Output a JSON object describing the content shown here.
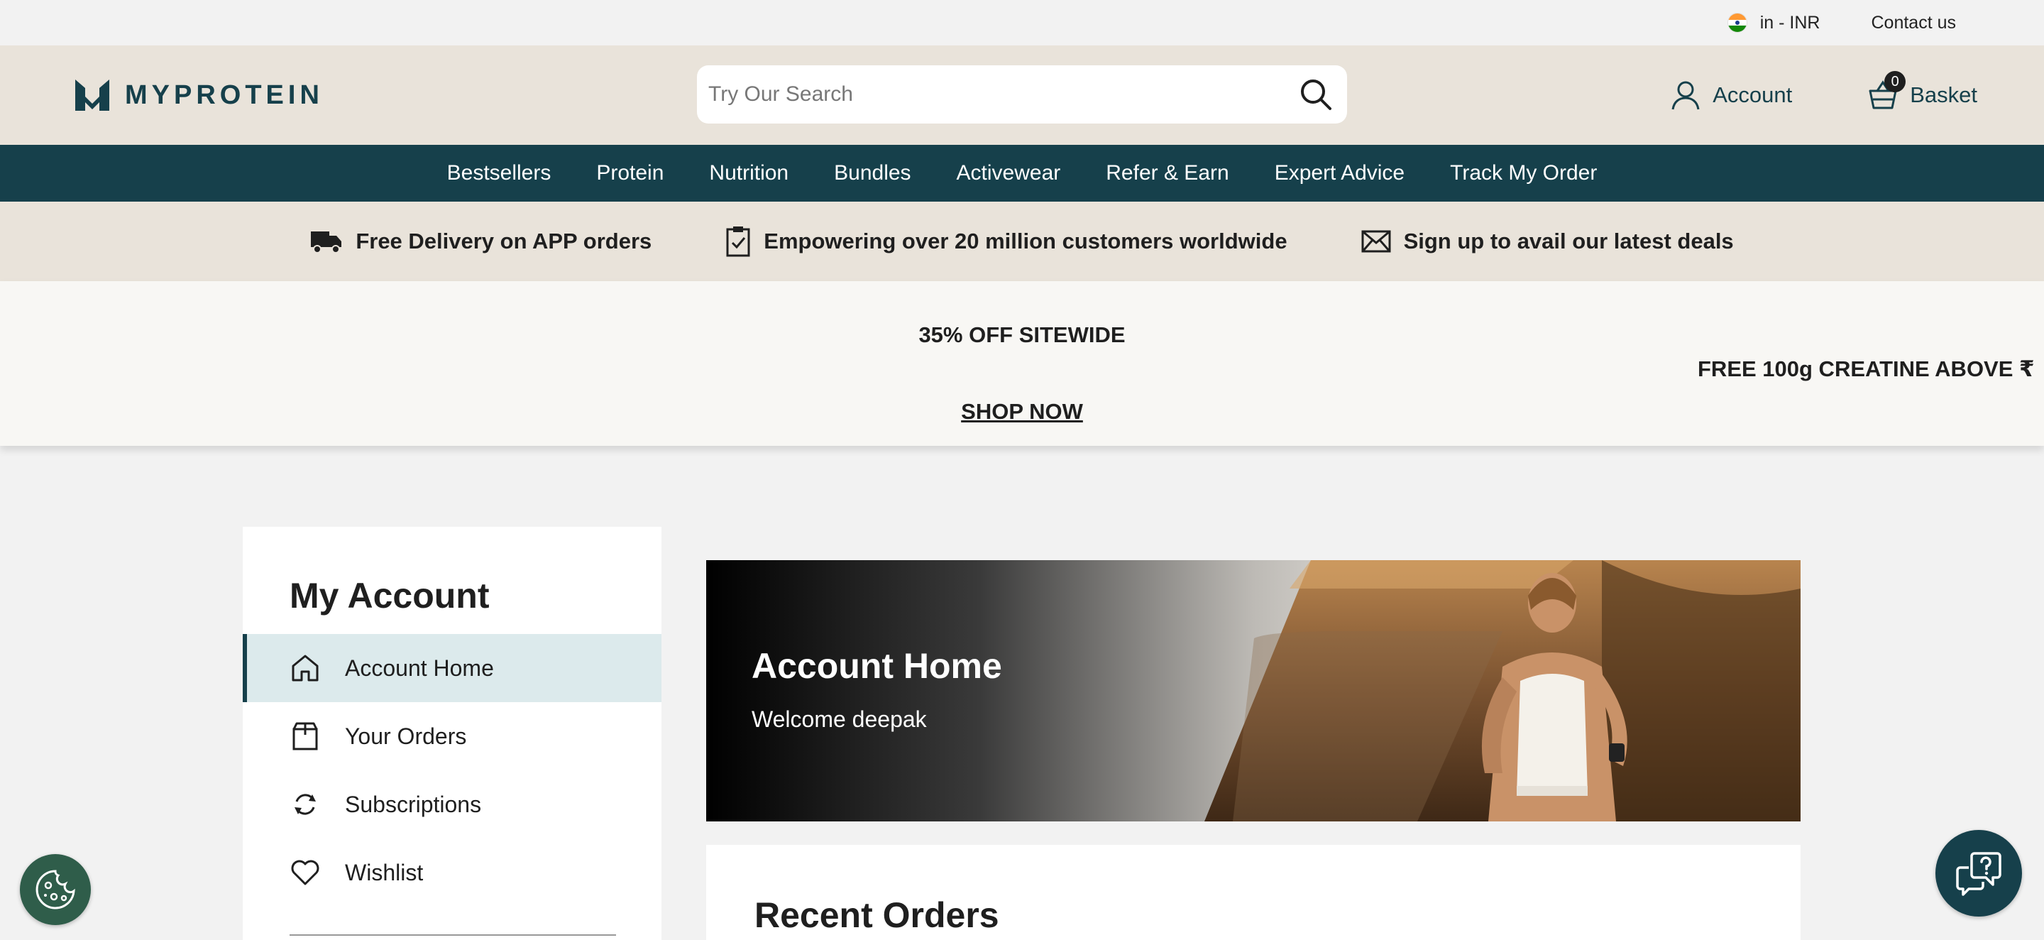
{
  "utility": {
    "locale": "in - INR",
    "contact": "Contact us"
  },
  "header": {
    "logo_text": "MYPROTEIN",
    "search_placeholder": "Try Our Search",
    "account": "Account",
    "basket": "Basket",
    "basket_count": "0"
  },
  "nav": {
    "items": [
      "Bestsellers",
      "Protein",
      "Nutrition",
      "Bundles",
      "Activewear",
      "Refer & Earn",
      "Expert Advice",
      "Track My Order"
    ]
  },
  "benefits": {
    "items": [
      {
        "icon": "truck-icon",
        "label": "Free Delivery on APP orders"
      },
      {
        "icon": "clipboard-check-icon",
        "label": "Empowering over 20 million customers worldwide"
      },
      {
        "icon": "envelope-icon",
        "label": "Sign up to avail our latest deals"
      }
    ]
  },
  "promo": {
    "title": "35% OFF SITEWIDE",
    "link": "SHOP NOW",
    "next_slide": "FREE 100g CREATINE ABOVE ₹"
  },
  "sidebar": {
    "title": "My Account",
    "items": [
      {
        "icon": "home-icon",
        "label": "Account Home",
        "active": true
      },
      {
        "icon": "box-icon",
        "label": "Your Orders"
      },
      {
        "icon": "refresh-icon",
        "label": "Subscriptions"
      },
      {
        "icon": "heart-icon",
        "label": "Wishlist"
      }
    ]
  },
  "hero": {
    "title": "Account Home",
    "subtitle": "Welcome deepak"
  },
  "orders": {
    "title": "Recent Orders"
  },
  "colors": {
    "brand_dark": "#16404b",
    "header_bg": "#e9e3da",
    "active_item_bg": "#dceaec",
    "cookie_button": "#2f5d4a"
  }
}
